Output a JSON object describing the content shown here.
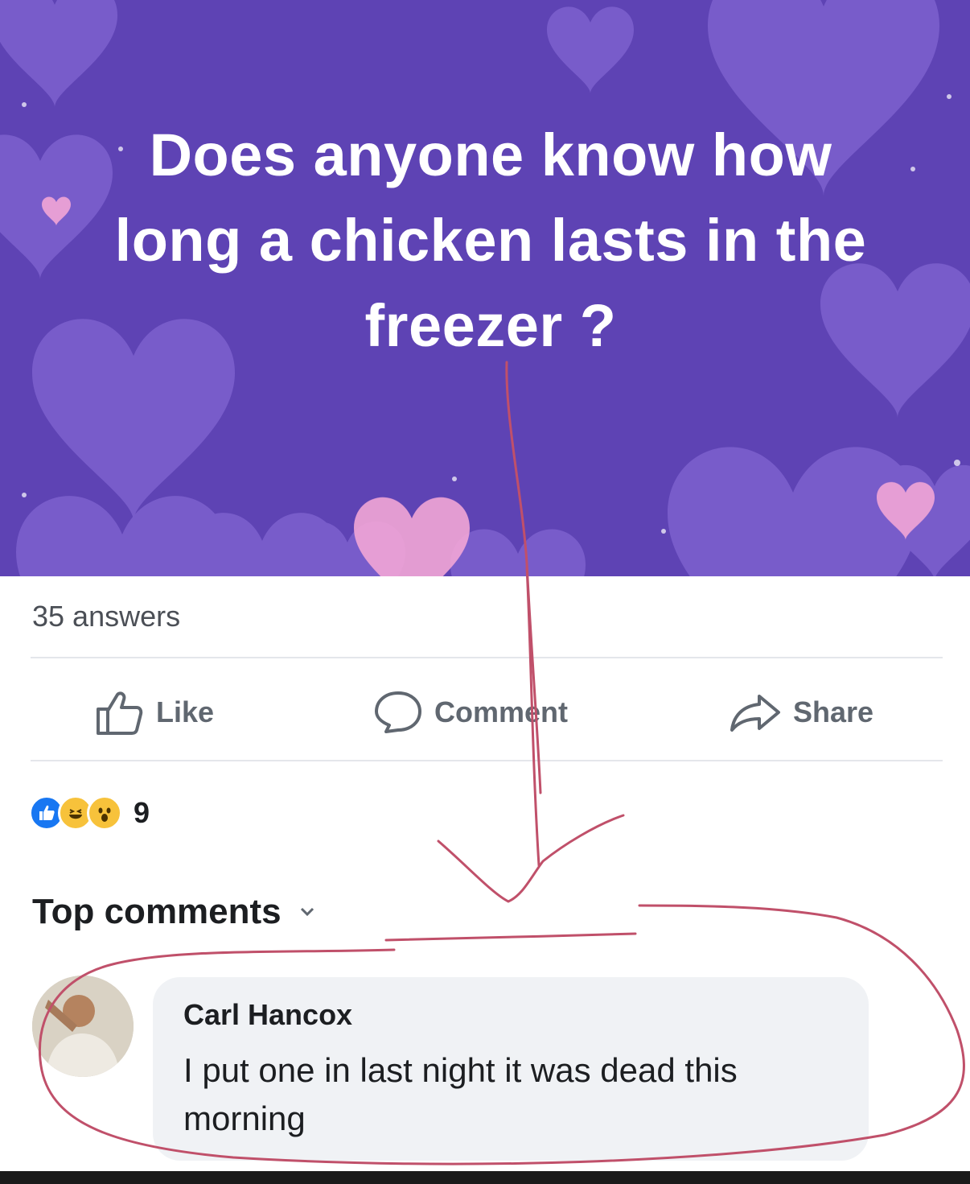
{
  "question": {
    "text": "Does anyone know how long a chicken lasts in the freezer ?"
  },
  "stats": {
    "answers": "35 answers"
  },
  "actions": {
    "like": "Like",
    "comment": "Comment",
    "share": "Share"
  },
  "reactions": {
    "types": [
      "like",
      "haha",
      "wow"
    ],
    "count": "9"
  },
  "comments_section": {
    "sort_label": "Top comments"
  },
  "comment": {
    "author": "Carl Hancox",
    "text": "I put one in last night it was dead this morning"
  },
  "colors": {
    "banner_background": "#5e43b4",
    "hearts": "#8e72dc",
    "pink_hearts": "#f3a6d6",
    "annotation_line": "#c0506a"
  }
}
